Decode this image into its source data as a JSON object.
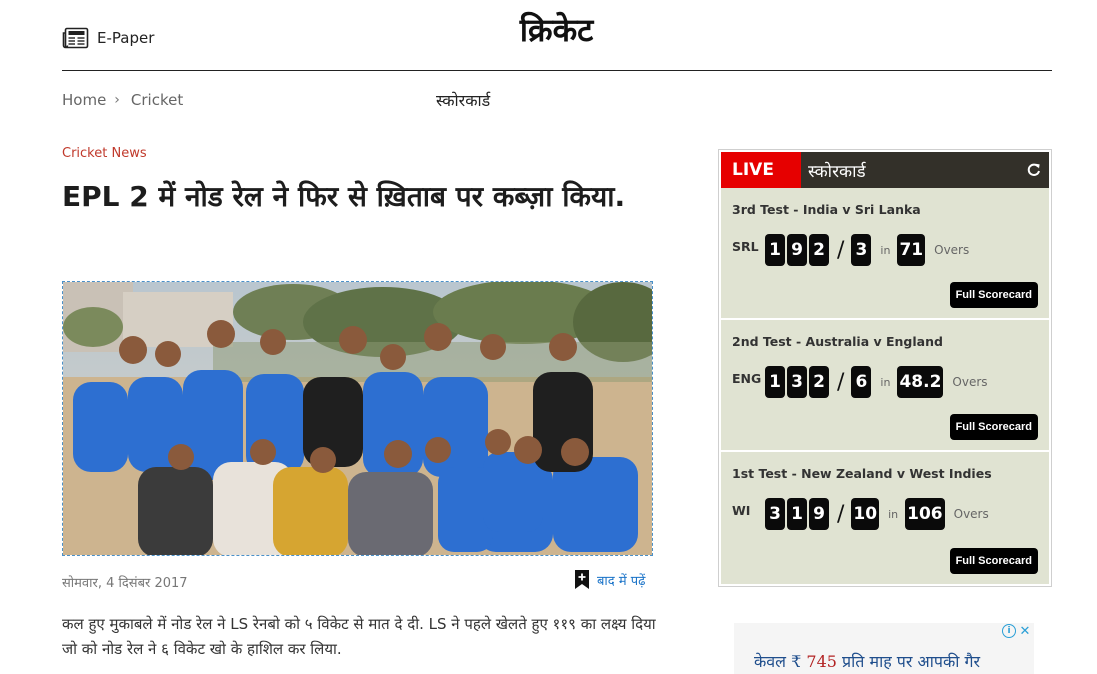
{
  "header": {
    "epaper_label": "E-Paper",
    "site_title": "क्रिकेट"
  },
  "breadcrumb": {
    "home": "Home",
    "separator": "›",
    "section": "Cricket"
  },
  "nav": {
    "scorecard": "स्कोरकार्ड"
  },
  "article": {
    "category": "Cricket News",
    "headline": "EPL 2 में नोड रेल ने फिर से ख़िताब पर कब्ज़ा किया.",
    "date": "सोमवार, 4 दिसंबर 2017",
    "read_later": "बाद में पढ़ें",
    "body": "कल हुए मुकाबले में नोड रेल ने LS रेनबो को ५ विकेट से मात दे दी. LS ने पहले खेलते हुए ११९ का लक्ष्य दिया जो को नोड रेल ने ६ विकेट खो के हाशिल कर लिया."
  },
  "scorecard_widget": {
    "live_label": "LIVE",
    "title": "स्कोरकार्ड",
    "in_label": "in",
    "overs_label": "Overs",
    "button_label": "Full Scorecard",
    "matches": [
      {
        "title": "3rd Test - India v Sri Lanka",
        "team": "SRL",
        "runs": "192",
        "wickets": "3",
        "overs": "71"
      },
      {
        "title": "2nd Test - Australia v England",
        "team": "ENG",
        "runs": "132",
        "wickets": "6",
        "overs": "48.2"
      },
      {
        "title": "1st Test - New Zealand v West Indies",
        "team": "WI",
        "runs": "319",
        "wickets": "10",
        "overs": "106"
      }
    ]
  },
  "ad": {
    "prefix": "केवल ₹",
    "price": "745",
    "suffix": "प्रति माह पर आपकी गैर"
  },
  "colors": {
    "live_red": "#e60000",
    "widget_header": "#333029",
    "score_panel": "#e0e3d2",
    "category_red": "#c0392b",
    "link_blue": "#1a73c8"
  },
  "icons": {
    "epaper": "newspaper-icon",
    "refresh": "refresh-icon",
    "read_later": "bookmark-plus-icon",
    "ad_info": "info-icon",
    "ad_close": "close-icon"
  }
}
